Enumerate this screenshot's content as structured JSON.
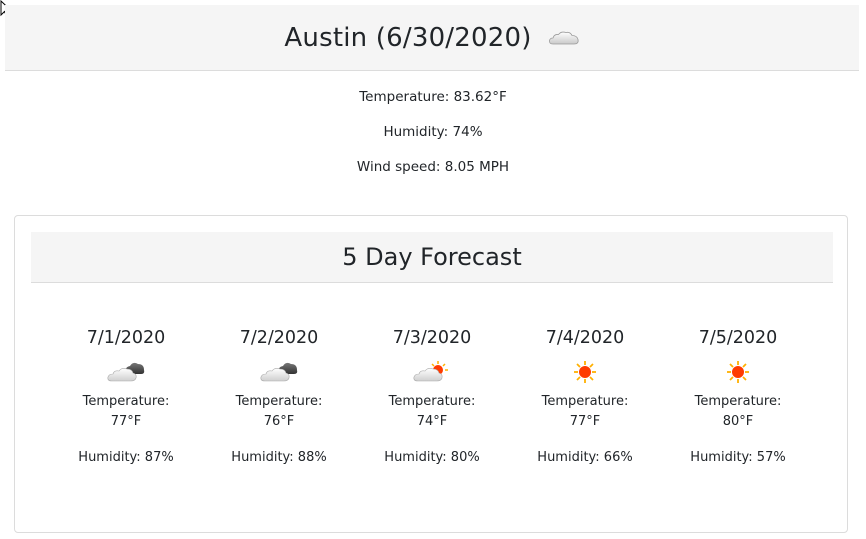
{
  "current": {
    "title": "Austin (6/30/2020)",
    "icon": "clouds-icon",
    "temperature": "Temperature: 83.62°F",
    "humidity": "Humidity: 74%",
    "wind": "Wind speed: 8.05 MPH"
  },
  "forecast": {
    "title": "5 Day Forecast",
    "days": [
      {
        "date": "7/1/2020",
        "icon": "broken-clouds-icon",
        "temp_label": "Temperature:",
        "temp": "77°F",
        "humidity": "Humidity: 87%"
      },
      {
        "date": "7/2/2020",
        "icon": "broken-clouds-icon",
        "temp_label": "Temperature:",
        "temp": "76°F",
        "humidity": "Humidity: 88%"
      },
      {
        "date": "7/3/2020",
        "icon": "partly-cloudy-icon",
        "temp_label": "Temperature:",
        "temp": "74°F",
        "humidity": "Humidity: 80%"
      },
      {
        "date": "7/4/2020",
        "icon": "sun-icon",
        "temp_label": "Temperature:",
        "temp": "77°F",
        "humidity": "Humidity: 66%"
      },
      {
        "date": "7/5/2020",
        "icon": "sun-icon",
        "temp_label": "Temperature:",
        "temp": "80°F",
        "humidity": "Humidity: 57%"
      }
    ]
  },
  "colors": {
    "header_bg": "#f5f5f5",
    "border": "#dcdcdc",
    "sun": "#ff3b00",
    "sun_rays": "#ffb000"
  }
}
